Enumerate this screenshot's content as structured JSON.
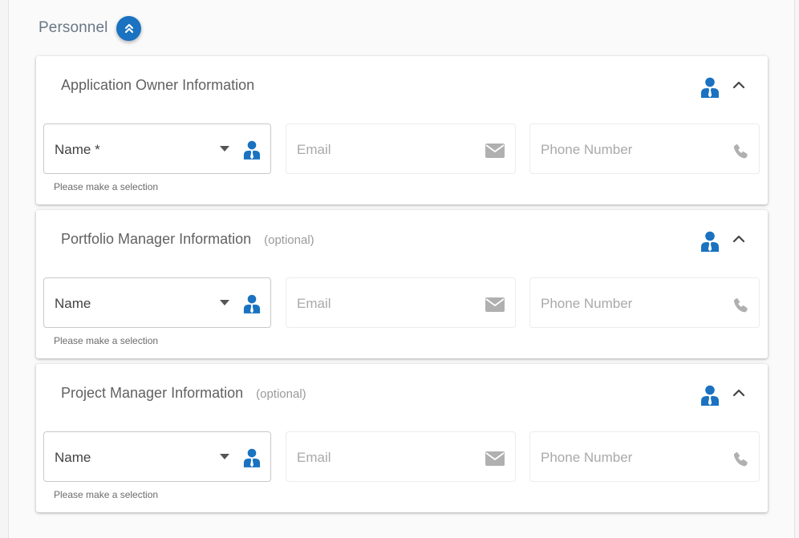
{
  "section": {
    "title": "Personnel",
    "collapse_icon": "double-chevron-up-icon"
  },
  "colors": {
    "accent": "#1a72c0",
    "icon_gray": "#b0b0b0",
    "title_gray": "#6a7785"
  },
  "cards": [
    {
      "title": "Application Owner Information",
      "optional": "",
      "person_icon": "person-tie-icon",
      "toggle_icon": "chevron-up-icon",
      "name_label": "Name *",
      "email_label": "Email",
      "phone_label": "Phone Number",
      "helper": "Please make a selection"
    },
    {
      "title": "Portfolio Manager Information",
      "optional": "(optional)",
      "person_icon": "person-tie-icon",
      "toggle_icon": "chevron-up-icon",
      "name_label": "Name",
      "email_label": "Email",
      "phone_label": "Phone Number",
      "helper": "Please make a selection"
    },
    {
      "title": "Project Manager Information",
      "optional": "(optional)",
      "person_icon": "person-tie-icon",
      "toggle_icon": "chevron-up-icon",
      "name_label": "Name",
      "email_label": "Email",
      "phone_label": "Phone Number",
      "helper": "Please make a selection"
    }
  ]
}
